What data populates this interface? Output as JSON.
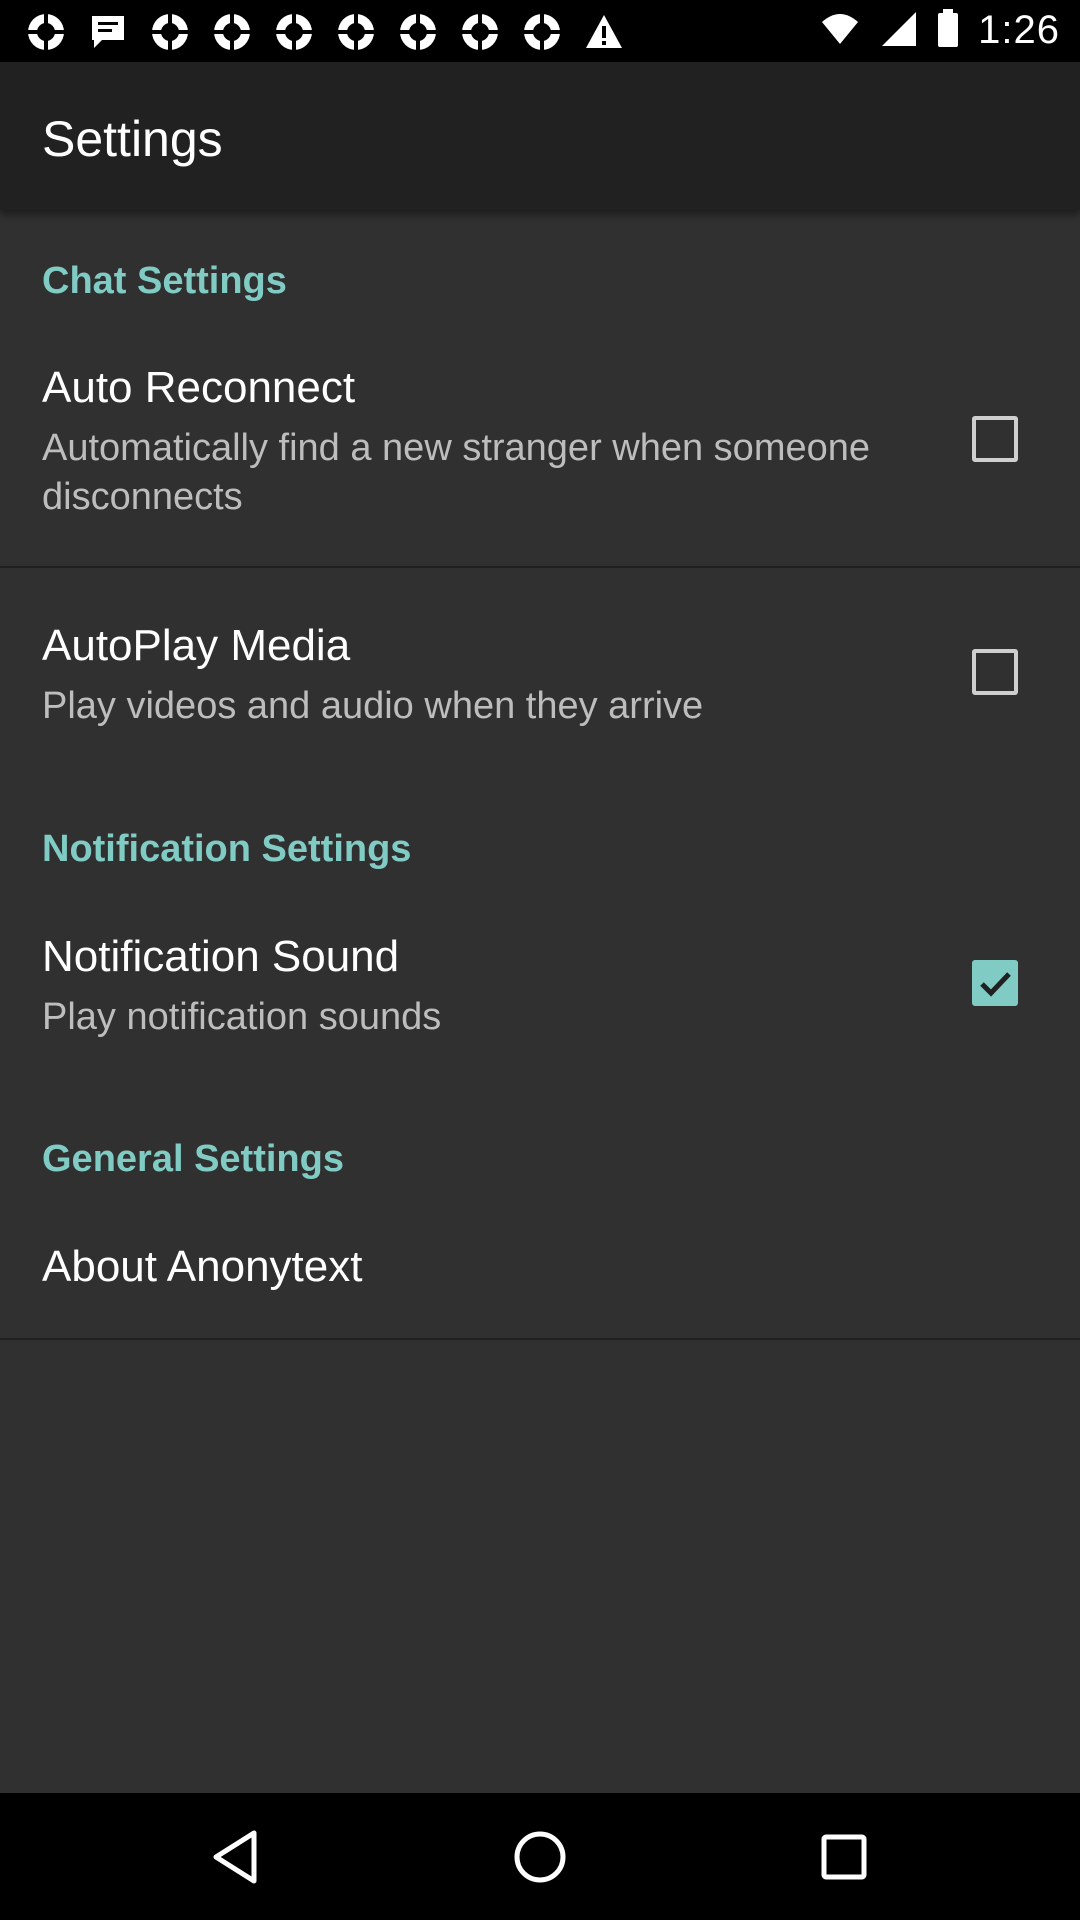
{
  "status_bar": {
    "time": "1:26",
    "notification_icons": [
      "app-logo-icon",
      "message-icon",
      "app-logo-icon",
      "app-logo-icon",
      "app-logo-icon",
      "app-logo-icon",
      "app-logo-icon",
      "app-logo-icon",
      "app-logo-icon",
      "warning-icon"
    ],
    "right_icons": [
      "wifi-icon",
      "signal-icon",
      "battery-icon"
    ]
  },
  "app_bar": {
    "title": "Settings"
  },
  "sections": {
    "chat": {
      "header": "Chat Settings",
      "auto_reconnect": {
        "title": "Auto Reconnect",
        "summary": "Automatically find a new stranger when someone disconnects",
        "checked": false
      },
      "autoplay_media": {
        "title": "AutoPlay Media",
        "summary": "Play videos and audio when they arrive",
        "checked": false
      }
    },
    "notification": {
      "header": "Notification Settings",
      "notification_sound": {
        "title": "Notification Sound",
        "summary": "Play notification sounds",
        "checked": true
      }
    },
    "general": {
      "header": "General Settings",
      "about": {
        "title": "About Anonytext"
      }
    }
  },
  "nav_bar": {
    "buttons": [
      "back-icon",
      "home-icon",
      "recents-icon"
    ]
  },
  "colors": {
    "background": "#303030",
    "app_bar": "#212121",
    "accent": "#80cbc4",
    "status_bar": "#000000"
  }
}
